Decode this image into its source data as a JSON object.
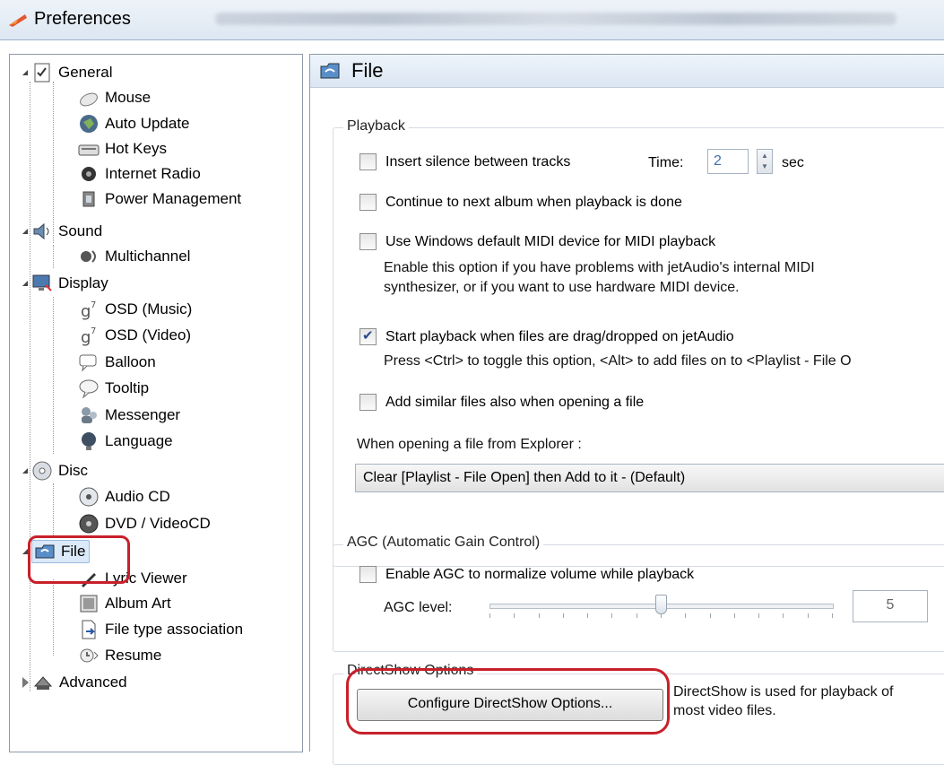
{
  "window": {
    "title": "Preferences"
  },
  "tree": {
    "items": [
      {
        "label": "General"
      },
      {
        "label": "Mouse"
      },
      {
        "label": "Auto Update"
      },
      {
        "label": "Hot Keys"
      },
      {
        "label": "Internet Radio"
      },
      {
        "label": "Power Management"
      },
      {
        "label": "Sound"
      },
      {
        "label": "Multichannel"
      },
      {
        "label": "Display"
      },
      {
        "label": "OSD (Music)"
      },
      {
        "label": "OSD (Video)"
      },
      {
        "label": "Balloon"
      },
      {
        "label": "Tooltip"
      },
      {
        "label": "Messenger"
      },
      {
        "label": "Language"
      },
      {
        "label": "Disc"
      },
      {
        "label": "Audio CD"
      },
      {
        "label": "DVD / VideoCD"
      },
      {
        "label": "File"
      },
      {
        "label": "Lyric Viewer"
      },
      {
        "label": "Album Art"
      },
      {
        "label": "File type association"
      },
      {
        "label": "Resume"
      },
      {
        "label": "Advanced"
      }
    ],
    "selected": "File"
  },
  "panel": {
    "title": "File",
    "playback": {
      "group_label": "Playback",
      "insert_silence": {
        "label": "Insert silence between tracks",
        "checked": false
      },
      "time_label": "Time:",
      "time_value": "2",
      "time_unit": "sec",
      "continue_next": {
        "label": "Continue to next album when playback is done",
        "checked": false
      },
      "midi": {
        "label": "Use Windows default MIDI device for MIDI playback",
        "checked": false
      },
      "midi_note_1": "Enable this option if you have problems with jetAudio's internal MIDI",
      "midi_note_2": "synthesizer, or if you want to use hardware MIDI device.",
      "start_on_drop": {
        "label": "Start playback when files are drag/dropped on jetAudio",
        "checked": true
      },
      "drop_note": "Press <Ctrl> to toggle this option, <Alt> to add files on to <Playlist - File O",
      "add_similar": {
        "label": "Add similar files also when opening a file",
        "checked": false
      },
      "explorer_label": "When opening a file from Explorer :",
      "explorer_option": "Clear [Playlist - File Open] then Add to it - (Default)"
    },
    "agc": {
      "group_label": "AGC (Automatic Gain Control)",
      "enable": {
        "label": "Enable AGC to normalize volume while playback",
        "checked": false
      },
      "level_label": "AGC level:",
      "level_value": "5",
      "level_fraction": 0.5
    },
    "directshow": {
      "group_label": "DirectShow Options",
      "button_label": "Configure DirectShow Options...",
      "desc_1": "DirectShow is used for playback of",
      "desc_2": "most video files."
    }
  },
  "colors": {
    "highlight": "#c8202a",
    "checkmark": "#2a4a8a"
  }
}
